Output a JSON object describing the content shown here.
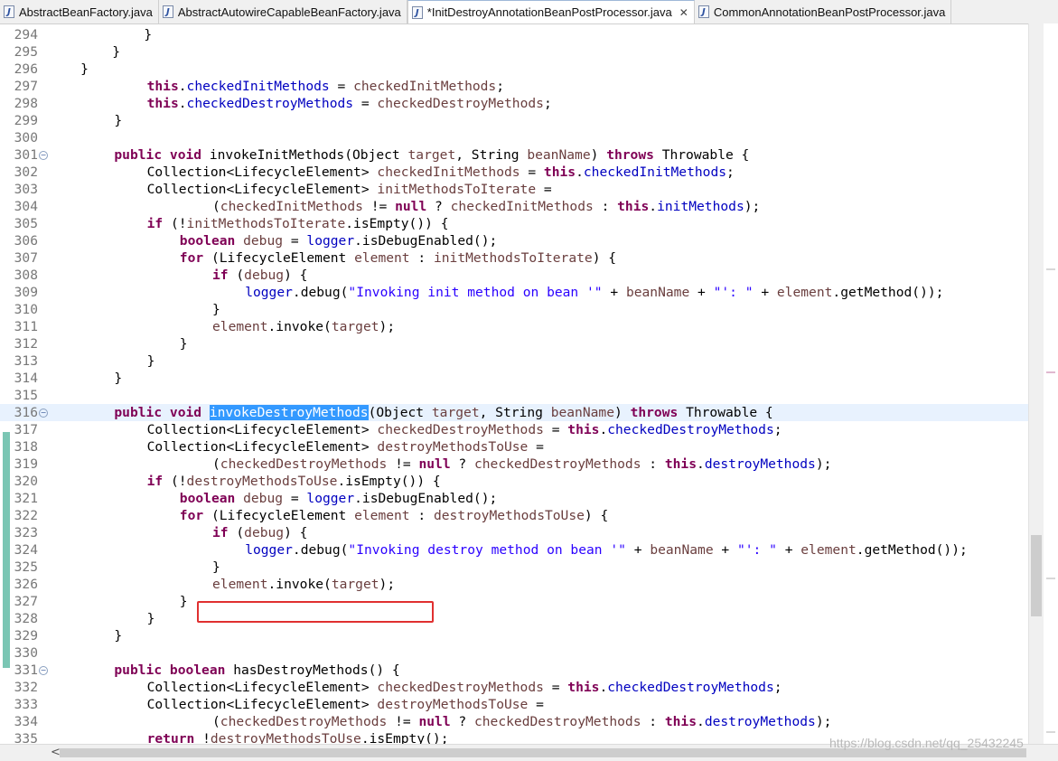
{
  "tabs": [
    {
      "label": "AbstractBeanFactory.java",
      "active": false,
      "icon": "java-file-icon"
    },
    {
      "label": "AbstractAutowireCapableBeanFactory.java",
      "active": false,
      "icon": "java-file-icon"
    },
    {
      "label": "*InitDestroyAnnotationBeanPostProcessor.java",
      "active": true,
      "icon": "java-file-icon",
      "close": "✕"
    },
    {
      "label": "CommonAnnotationBeanPostProcessor.java",
      "active": false,
      "icon": "java-file-icon"
    }
  ],
  "editor": {
    "current_line": 316,
    "selected_text": "invokeDestroyMethods",
    "highlighted_line": 326,
    "lines": [
      {
        "n": 294,
        "tokens": [
          [
            "",
            "\t\t\t}"
          ]
        ]
      },
      {
        "n": 295,
        "tokens": [
          [
            "",
            "\t\t}"
          ]
        ]
      },
      {
        "n": 296,
        "tokens": [
          [
            "",
            "\t}"
          ]
        ]
      },
      {
        "n": 297,
        "tokens": [
          [
            "kw",
            "this"
          ],
          [
            "",
            "."
          ],
          [
            "fld",
            "checkedInitMethods"
          ],
          [
            "",
            " = "
          ],
          [
            "var",
            "checkedInitMethods"
          ],
          [
            "",
            ";"
          ]
        ],
        "indent": 3
      },
      {
        "n": 298,
        "tokens": [
          [
            "kw",
            "this"
          ],
          [
            "",
            "."
          ],
          [
            "fld",
            "checkedDestroyMethods"
          ],
          [
            "",
            " = "
          ],
          [
            "var",
            "checkedDestroyMethods"
          ],
          [
            "",
            ";"
          ]
        ],
        "indent": 3
      },
      {
        "n": 299,
        "tokens": [
          [
            "",
            "}"
          ]
        ],
        "indent": 2
      },
      {
        "n": 300,
        "tokens": []
      },
      {
        "n": 301,
        "fold": true,
        "indent": 2,
        "tokens": [
          [
            "kw",
            "public"
          ],
          [
            "",
            " "
          ],
          [
            "kw",
            "void"
          ],
          [
            "",
            " invokeInitMethods(Object "
          ],
          [
            "var",
            "target"
          ],
          [
            "",
            ", String "
          ],
          [
            "var",
            "beanName"
          ],
          [
            "",
            ") "
          ],
          [
            "kw",
            "throws"
          ],
          [
            "",
            " Throwable {"
          ]
        ]
      },
      {
        "n": 302,
        "indent": 3,
        "tokens": [
          [
            "",
            "Collection<LifecycleElement> "
          ],
          [
            "var",
            "checkedInitMethods"
          ],
          [
            "",
            " = "
          ],
          [
            "kw",
            "this"
          ],
          [
            "",
            "."
          ],
          [
            "fld",
            "checkedInitMethods"
          ],
          [
            "",
            ";"
          ]
        ]
      },
      {
        "n": 303,
        "indent": 3,
        "tokens": [
          [
            "",
            "Collection<LifecycleElement> "
          ],
          [
            "var",
            "initMethodsToIterate"
          ],
          [
            "",
            " ="
          ]
        ]
      },
      {
        "n": 304,
        "indent": 5,
        "tokens": [
          [
            "",
            "("
          ],
          [
            "var",
            "checkedInitMethods"
          ],
          [
            "",
            " != "
          ],
          [
            "kw",
            "null"
          ],
          [
            "",
            " ? "
          ],
          [
            "var",
            "checkedInitMethods"
          ],
          [
            "",
            " : "
          ],
          [
            "kw",
            "this"
          ],
          [
            "",
            "."
          ],
          [
            "fld",
            "initMethods"
          ],
          [
            "",
            ");"
          ]
        ]
      },
      {
        "n": 305,
        "indent": 3,
        "tokens": [
          [
            "kw",
            "if"
          ],
          [
            "",
            " (!"
          ],
          [
            "var",
            "initMethodsToIterate"
          ],
          [
            "",
            ".isEmpty()) {"
          ]
        ]
      },
      {
        "n": 306,
        "indent": 4,
        "tokens": [
          [
            "kw",
            "boolean"
          ],
          [
            "",
            " "
          ],
          [
            "var",
            "debug"
          ],
          [
            "",
            " = "
          ],
          [
            "fld",
            "logger"
          ],
          [
            "",
            ".isDebugEnabled();"
          ]
        ]
      },
      {
        "n": 307,
        "indent": 4,
        "tokens": [
          [
            "kw",
            "for"
          ],
          [
            "",
            " (LifecycleElement "
          ],
          [
            "var",
            "element"
          ],
          [
            "",
            " : "
          ],
          [
            "var",
            "initMethodsToIterate"
          ],
          [
            "",
            ") {"
          ]
        ]
      },
      {
        "n": 308,
        "indent": 5,
        "tokens": [
          [
            "kw",
            "if"
          ],
          [
            "",
            " ("
          ],
          [
            "var",
            "debug"
          ],
          [
            "",
            ") {"
          ]
        ]
      },
      {
        "n": 309,
        "indent": 6,
        "tokens": [
          [
            "fld",
            "logger"
          ],
          [
            "",
            ".debug("
          ],
          [
            "str",
            "\"Invoking init method on bean '\""
          ],
          [
            "",
            " + "
          ],
          [
            "var",
            "beanName"
          ],
          [
            "",
            " + "
          ],
          [
            "str",
            "\"': \""
          ],
          [
            "",
            " + "
          ],
          [
            "var",
            "element"
          ],
          [
            "",
            ".getMethod());"
          ]
        ]
      },
      {
        "n": 310,
        "indent": 5,
        "tokens": [
          [
            "",
            "}"
          ]
        ]
      },
      {
        "n": 311,
        "indent": 5,
        "tokens": [
          [
            "var",
            "element"
          ],
          [
            "",
            ".invoke("
          ],
          [
            "var",
            "target"
          ],
          [
            "",
            ");"
          ]
        ]
      },
      {
        "n": 312,
        "indent": 4,
        "tokens": [
          [
            "",
            "}"
          ]
        ]
      },
      {
        "n": 313,
        "indent": 3,
        "tokens": [
          [
            "",
            "}"
          ]
        ]
      },
      {
        "n": 314,
        "indent": 2,
        "tokens": [
          [
            "",
            "}"
          ]
        ]
      },
      {
        "n": 315,
        "tokens": []
      },
      {
        "n": 316,
        "fold": true,
        "indent": 2,
        "tokens": [
          [
            "kw",
            "public"
          ],
          [
            "",
            " "
          ],
          [
            "kw",
            "void"
          ],
          [
            "",
            " "
          ],
          [
            "sel",
            "invokeDestroyMethods"
          ],
          [
            "",
            "(Object "
          ],
          [
            "var",
            "target"
          ],
          [
            "",
            ", String "
          ],
          [
            "var",
            "beanName"
          ],
          [
            "",
            ") "
          ],
          [
            "kw",
            "throws"
          ],
          [
            "",
            " Throwable {"
          ]
        ]
      },
      {
        "n": 317,
        "indent": 3,
        "tokens": [
          [
            "",
            "Collection<LifecycleElement> "
          ],
          [
            "var",
            "checkedDestroyMethods"
          ],
          [
            "",
            " = "
          ],
          [
            "kw",
            "this"
          ],
          [
            "",
            "."
          ],
          [
            "fld",
            "checkedDestroyMethods"
          ],
          [
            "",
            ";"
          ]
        ]
      },
      {
        "n": 318,
        "indent": 3,
        "tokens": [
          [
            "",
            "Collection<LifecycleElement> "
          ],
          [
            "var",
            "destroyMethodsToUse"
          ],
          [
            "",
            " ="
          ]
        ]
      },
      {
        "n": 319,
        "indent": 5,
        "tokens": [
          [
            "",
            "("
          ],
          [
            "var",
            "checkedDestroyMethods"
          ],
          [
            "",
            " != "
          ],
          [
            "kw",
            "null"
          ],
          [
            "",
            " ? "
          ],
          [
            "var",
            "checkedDestroyMethods"
          ],
          [
            "",
            " : "
          ],
          [
            "kw",
            "this"
          ],
          [
            "",
            "."
          ],
          [
            "fld",
            "destroyMethods"
          ],
          [
            "",
            ");"
          ]
        ]
      },
      {
        "n": 320,
        "indent": 3,
        "tokens": [
          [
            "kw",
            "if"
          ],
          [
            "",
            " (!"
          ],
          [
            "var",
            "destroyMethodsToUse"
          ],
          [
            "",
            ".isEmpty()) {"
          ]
        ]
      },
      {
        "n": 321,
        "indent": 4,
        "tokens": [
          [
            "kw",
            "boolean"
          ],
          [
            "",
            " "
          ],
          [
            "var",
            "debug"
          ],
          [
            "",
            " = "
          ],
          [
            "fld",
            "logger"
          ],
          [
            "",
            ".isDebugEnabled();"
          ]
        ]
      },
      {
        "n": 322,
        "indent": 4,
        "tokens": [
          [
            "kw",
            "for"
          ],
          [
            "",
            " (LifecycleElement "
          ],
          [
            "var",
            "element"
          ],
          [
            "",
            " : "
          ],
          [
            "var",
            "destroyMethodsToUse"
          ],
          [
            "",
            ") {"
          ]
        ]
      },
      {
        "n": 323,
        "indent": 5,
        "tokens": [
          [
            "kw",
            "if"
          ],
          [
            "",
            " ("
          ],
          [
            "var",
            "debug"
          ],
          [
            "",
            ") {"
          ]
        ]
      },
      {
        "n": 324,
        "indent": 6,
        "tokens": [
          [
            "fld",
            "logger"
          ],
          [
            "",
            ".debug("
          ],
          [
            "str",
            "\"Invoking destroy method on bean '\""
          ],
          [
            "",
            " + "
          ],
          [
            "var",
            "beanName"
          ],
          [
            "",
            " + "
          ],
          [
            "str",
            "\"': \""
          ],
          [
            "",
            " + "
          ],
          [
            "var",
            "element"
          ],
          [
            "",
            ".getMethod());"
          ]
        ]
      },
      {
        "n": 325,
        "indent": 5,
        "tokens": [
          [
            "",
            "}"
          ]
        ]
      },
      {
        "n": 326,
        "indent": 5,
        "tokens": [
          [
            "var",
            "element"
          ],
          [
            "",
            ".invoke("
          ],
          [
            "var",
            "target"
          ],
          [
            "",
            ");"
          ]
        ]
      },
      {
        "n": 327,
        "indent": 4,
        "tokens": [
          [
            "",
            "}"
          ]
        ]
      },
      {
        "n": 328,
        "indent": 3,
        "tokens": [
          [
            "",
            "}"
          ]
        ]
      },
      {
        "n": 329,
        "indent": 2,
        "tokens": [
          [
            "",
            "}"
          ]
        ]
      },
      {
        "n": 330,
        "tokens": []
      },
      {
        "n": 331,
        "fold": true,
        "indent": 2,
        "tokens": [
          [
            "kw",
            "public"
          ],
          [
            "",
            " "
          ],
          [
            "kw",
            "boolean"
          ],
          [
            "",
            " hasDestroyMethods() {"
          ]
        ]
      },
      {
        "n": 332,
        "indent": 3,
        "tokens": [
          [
            "",
            "Collection<LifecycleElement> "
          ],
          [
            "var",
            "checkedDestroyMethods"
          ],
          [
            "",
            " = "
          ],
          [
            "kw",
            "this"
          ],
          [
            "",
            "."
          ],
          [
            "fld",
            "checkedDestroyMethods"
          ],
          [
            "",
            ";"
          ]
        ]
      },
      {
        "n": 333,
        "indent": 3,
        "tokens": [
          [
            "",
            "Collection<LifecycleElement> "
          ],
          [
            "var",
            "destroyMethodsToUse"
          ],
          [
            "",
            " ="
          ]
        ]
      },
      {
        "n": 334,
        "indent": 5,
        "tokens": [
          [
            "",
            "("
          ],
          [
            "var",
            "checkedDestroyMethods"
          ],
          [
            "",
            " != "
          ],
          [
            "kw",
            "null"
          ],
          [
            "",
            " ? "
          ],
          [
            "var",
            "checkedDestroyMethods"
          ],
          [
            "",
            " : "
          ],
          [
            "kw",
            "this"
          ],
          [
            "",
            "."
          ],
          [
            "fld",
            "destroyMethods"
          ],
          [
            "",
            ");"
          ]
        ]
      },
      {
        "n": 335,
        "indent": 3,
        "tokens": [
          [
            "kw",
            "return"
          ],
          [
            "",
            " !"
          ],
          [
            "var",
            "destroyMethodsToUse"
          ],
          [
            "",
            ".isEmpty();"
          ]
        ]
      }
    ]
  },
  "colors": {
    "keyword": "#7f0055",
    "field": "#0000c0",
    "local_var": "#6a3e3e",
    "string": "#2a00ff",
    "selection": "#3399ff",
    "current_line": "#e8f2fe",
    "change_bar": "#7bc6b4",
    "highlight_box": "#e03030"
  },
  "scroll": {
    "left_arrow": "<"
  },
  "watermark": "https://blog.csdn.net/qq_25432245"
}
